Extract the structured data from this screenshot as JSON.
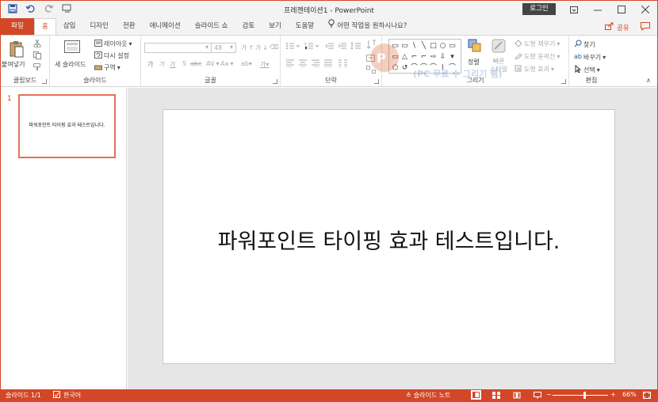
{
  "window": {
    "title": "프레젠테이션1  -  PowerPoint",
    "login_label": "로그인",
    "controls": [
      "ribbon-display-icon",
      "minimize-icon",
      "maximize-icon",
      "close-icon"
    ]
  },
  "quick_access": [
    "save-icon",
    "undo-icon",
    "redo-icon",
    "customize-qat-icon"
  ],
  "tabs": {
    "file": "파일",
    "items": [
      "홈",
      "삽입",
      "디자인",
      "전환",
      "애니메이션",
      "슬라이드 쇼",
      "검토",
      "보기",
      "도움말"
    ],
    "active": "홈",
    "tell_me": "어떤 작업을 원하시나요?",
    "share": "공유"
  },
  "ribbon": {
    "groups": {
      "clipboard": "클립보드",
      "slides": "슬라이드",
      "font": "글꼴",
      "paragraph": "단락",
      "drawing": "그리기",
      "editing": "편집"
    },
    "clipboard": {
      "paste": "붙여넣기"
    },
    "slides": {
      "new_slide": "새 슬라이드",
      "layout": "레이아웃",
      "reset": "다시 설정",
      "section": "구역"
    },
    "font": {
      "font_name": "",
      "font_size": "48",
      "bold": "가",
      "italic": "가",
      "underline": "가",
      "strike": "S",
      "shadow": "abc",
      "spacing": "AV",
      "case": "Aa",
      "grow": "가",
      "shrink": "가"
    },
    "drawing": {
      "arrange": "정렬",
      "quick_styles": "빠른 스타일",
      "fill": "도형 채우기",
      "outline": "도형 윤곽선",
      "effects": "도형 효과",
      "shapes": [
        "▭",
        "▭",
        "\\",
        "╲",
        "□",
        "○",
        "▭",
        "▭",
        "△",
        "⌐",
        "⌐",
        "⇨",
        "⇩",
        "▾",
        "⬠",
        "↺",
        "⌒",
        "⌒",
        "⌒",
        "⌇",
        "⌒"
      ]
    },
    "editing": {
      "find": "찾기",
      "replace": "바꾸기",
      "select": "선택"
    }
  },
  "watermark": {
    "text": "(PC 무료 수 그리기 램)"
  },
  "thumbnails": [
    {
      "number": "1",
      "text": "파워포인트 타이핑 효과 테스트입니다."
    }
  ],
  "slide": {
    "text": "파워포인트 타이핑 효과 테스트입니다."
  },
  "status": {
    "slide_count": "슬라이드 1/1",
    "language": "한국어",
    "notes": "슬라이드 노트",
    "zoom": "66%",
    "zoom_level_fraction": 0.66
  },
  "colors": {
    "accent": "#d24726",
    "status_bar": "#d24726",
    "thumb_border": "#e2735a"
  }
}
